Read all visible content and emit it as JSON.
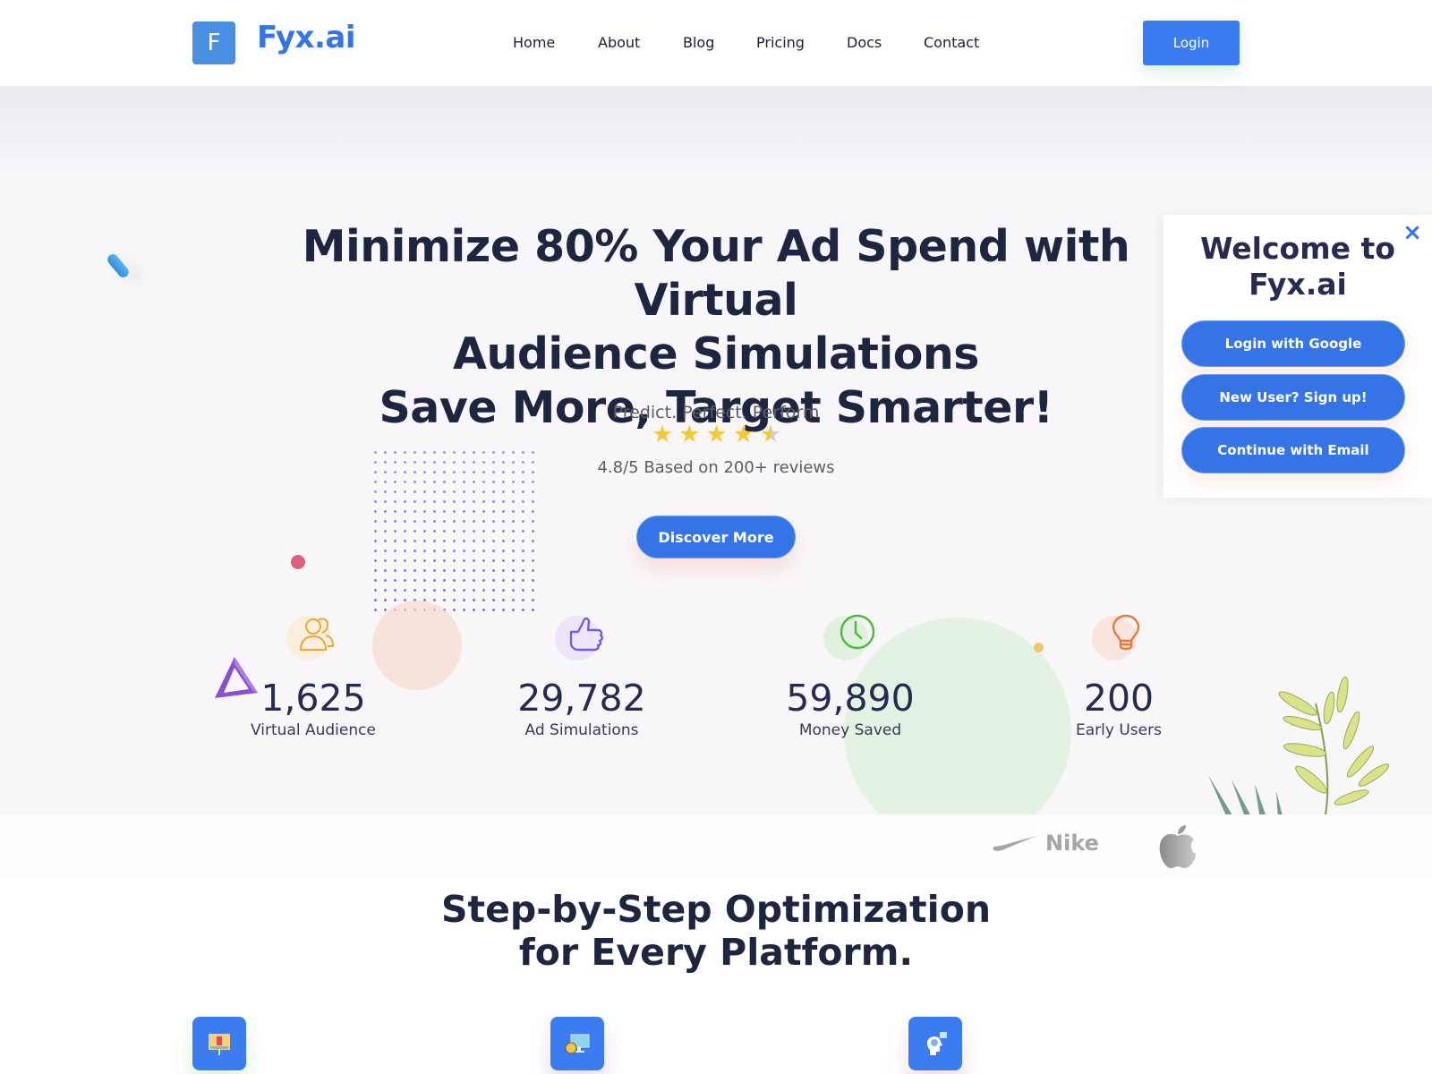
{
  "header": {
    "logo_letter": "F",
    "brand_name": "Fyx.ai",
    "nav": [
      "Home",
      "About",
      "Blog",
      "Pricing",
      "Docs",
      "Contact"
    ],
    "login_label": "Login"
  },
  "hero": {
    "title_lines": [
      "Minimize 80% Your Ad Spend with Virtual",
      "Audience Simulations",
      "Save More, Target Smarter!"
    ],
    "tagline": "Predict. Perfect. Perform",
    "rating": {
      "value": 4.8,
      "max": 5,
      "stars_filled": 4.5
    },
    "rating_text": "4.8/5 Based on 200+ reviews",
    "cta_label": "Discover More"
  },
  "stats": [
    {
      "icon": "users-icon",
      "value": "1,625",
      "label": "Virtual Audience",
      "color": "#e8a83a",
      "bg": "#fbeedd"
    },
    {
      "icon": "thumbs-up-icon",
      "value": "29,782",
      "label": "Ad Simulations",
      "color": "#7a5ae0",
      "bg": "#ece6f8"
    },
    {
      "icon": "clock-icon",
      "value": "59,890",
      "label": "Money Saved",
      "color": "#4cba3c",
      "bg": "#e1f1df"
    },
    {
      "icon": "lightbulb-icon",
      "value": "200",
      "label": "Early Users",
      "color": "#e57a3a",
      "bg": "#fbe5df"
    }
  ],
  "brands": [
    {
      "name": "Nike",
      "icon": "nike-swoosh-icon"
    },
    {
      "name": "Apple",
      "icon": "apple-logo-icon"
    }
  ],
  "section": {
    "title_lines": [
      "Step-by-Step Optimization",
      "for Every Platform."
    ],
    "steps": [
      {
        "icon": "presentation-board-icon"
      },
      {
        "icon": "monitor-coin-icon"
      },
      {
        "icon": "head-chart-icon"
      }
    ]
  },
  "modal": {
    "title_lines": [
      "Welcome to",
      "Fyx.ai"
    ],
    "close_icon": "×",
    "buttons": [
      "Login with Google",
      "New User? Sign up!",
      "Continue with Email"
    ]
  },
  "colors": {
    "brand_blue": "#3474e6",
    "heading_dark": "#1e2540",
    "star_yellow": "#f5c83a"
  }
}
